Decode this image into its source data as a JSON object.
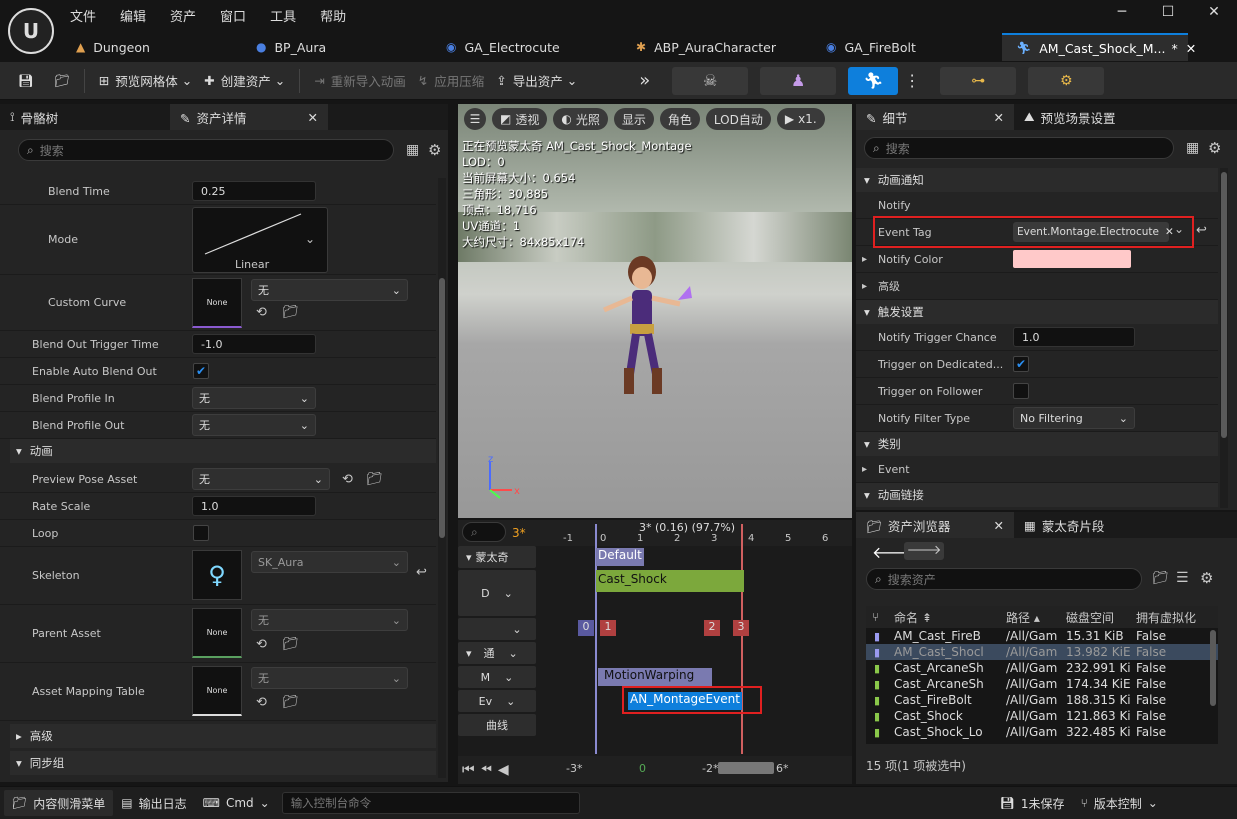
{
  "menu": [
    "文件",
    "编辑",
    "资产",
    "窗口",
    "工具",
    "帮助"
  ],
  "window_controls": [
    "─",
    "☐",
    "✕"
  ],
  "tabs": [
    {
      "label": "Dungeon",
      "icon": "level-icon"
    },
    {
      "label": "BP_Aura",
      "icon": "blueprint-icon"
    },
    {
      "label": "GA_Electrocute",
      "icon": "ability-icon"
    },
    {
      "label": "ABP_AuraCharacter",
      "icon": "anim-blueprint-icon"
    },
    {
      "label": "GA_FireBolt",
      "icon": "ability-icon"
    },
    {
      "label": "AM_Cast_Shock_M...",
      "icon": "montage-icon",
      "modified": "*",
      "close": "✕"
    }
  ],
  "toolbar": {
    "preview_mesh": "预览网格体",
    "create_asset": "创建资产",
    "reimport": "重新导入动画",
    "apply_compression": "应用压缩",
    "export_asset": "导出资产"
  },
  "left_panel": {
    "tab_skeleton": "骨骼树",
    "tab_details": "资产详情",
    "search_placeholder": "搜索",
    "blend_time_label": "Blend Time",
    "blend_time": "0.25",
    "mode_label": "Mode",
    "mode_value": "Linear",
    "custom_curve_label": "Custom Curve",
    "none": "None",
    "custom_curve_value": "无",
    "blend_out_trigger_label": "Blend Out Trigger Time",
    "blend_out_trigger": "-1.0",
    "auto_blend_label": "Enable Auto Blend Out",
    "profile_in_label": "Blend Profile In",
    "profile_in": "无",
    "profile_out_label": "Blend Profile Out",
    "profile_out": "无",
    "section_anim": "动画",
    "preview_pose_label": "Preview Pose Asset",
    "preview_pose": "无",
    "rate_scale_label": "Rate Scale",
    "rate_scale": "1.0",
    "loop_label": "Loop",
    "skeleton_label": "Skeleton",
    "skeleton_value": "SK_Aura",
    "parent_label": "Parent Asset",
    "parent_value": "无",
    "mapping_label": "Asset Mapping Table",
    "mapping_value": "无",
    "section_advanced": "高级",
    "section_sync": "同步组"
  },
  "viewport": {
    "buttons": [
      "透视",
      "光照",
      "显示",
      "角色",
      "LOD自动",
      "x1."
    ],
    "info": [
      "正在预览蒙太奇 AM_Cast_Shock_Montage",
      "LOD：0",
      "当前屏幕大小：0.654",
      "三角形：30,885",
      "顶点：18,716",
      "UV通道：1",
      "大约尺寸：84x85x174"
    ]
  },
  "timeline": {
    "frame_label": "3*",
    "position": "3* (0.16) (97.7%)",
    "ticks": [
      "-1",
      "0",
      "1",
      "2",
      "3",
      "4",
      "5",
      "6"
    ],
    "montage_row": "蒙太奇",
    "default_slot": "Default",
    "cast_shock": "Cast_Shock",
    "d_row": "D",
    "markers": [
      "0",
      "1",
      "2",
      "3"
    ],
    "notify_row": "通",
    "motion_row": "M",
    "ev_row": "Ev",
    "curves_row": "曲线",
    "motion_warping": "MotionWarping",
    "montage_event": "AN_MontageEvent",
    "bottom": [
      "-3*",
      "0",
      "-2*",
      "6*"
    ]
  },
  "details": {
    "tab_details": "细节",
    "tab_preview": "预览场景设置",
    "search_placeholder": "搜索",
    "section_notify": "动画通知",
    "notify_label": "Notify",
    "event_tag_label": "Event Tag",
    "event_tag": "Event.Montage.Electrocute",
    "notify_color_label": "Notify Color",
    "notify_color": "#ffc9c9",
    "section_adv": "高级",
    "section_trigger": "触发设置",
    "trigger_chance_label": "Notify Trigger Chance",
    "trigger_chance": "1.0",
    "dedicated_label": "Trigger on Dedicated...",
    "follower_label": "Trigger on Follower",
    "filter_label": "Notify Filter Type",
    "filter_value": "No Filtering",
    "section_category": "类别",
    "event_label": "Event",
    "section_link": "动画链接"
  },
  "content_browser": {
    "tab_browser": "资产浏览器",
    "tab_clips": "蒙太奇片段",
    "search_placeholder": "搜索资产",
    "columns": [
      "命名",
      "路径",
      "磁盘空间",
      "拥有虚拟化"
    ],
    "rows": [
      {
        "name": "AM_Cast_FireB",
        "path": "/All/Gam",
        "size": "15.31 KiB",
        "virt": "False"
      },
      {
        "name": "AM_Cast_Shocl",
        "path": "/All/Gam",
        "size": "13.982 KiE",
        "virt": "False"
      },
      {
        "name": "Cast_ArcaneSh",
        "path": "/All/Gam",
        "size": "232.991 Ki",
        "virt": "False"
      },
      {
        "name": "Cast_ArcaneSh",
        "path": "/All/Gam",
        "size": "174.34 KiE",
        "virt": "False"
      },
      {
        "name": "Cast_FireBolt",
        "path": "/All/Gam",
        "size": "188.315 Ki",
        "virt": "False"
      },
      {
        "name": "Cast_Shock",
        "path": "/All/Gam",
        "size": "121.863 Ki",
        "virt": "False"
      },
      {
        "name": "Cast_Shock_Lo",
        "path": "/All/Gam",
        "size": "322.485 Ki",
        "virt": "False"
      }
    ],
    "count": "15 项(1 项被选中)"
  },
  "statusbar": {
    "drawer": "内容侧滑菜单",
    "output_log": "输出日志",
    "cmd": "Cmd",
    "cmd_placeholder": "输入控制台命令",
    "unsaved": "1未保存",
    "source_control": "版本控制"
  }
}
